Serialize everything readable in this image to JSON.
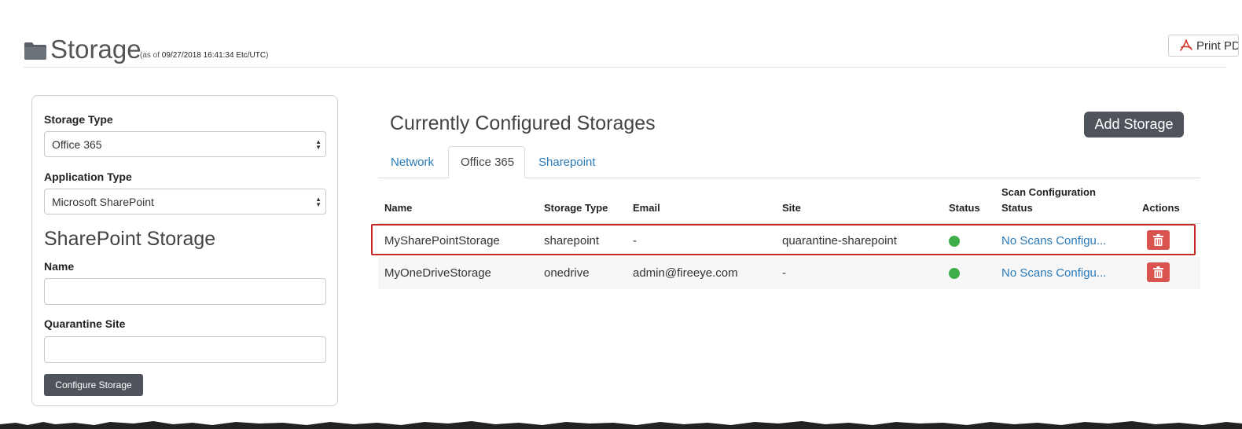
{
  "header": {
    "title": "Storage",
    "asof_prefix": "(as of ",
    "asof_value": "09/27/2018 16:41:34 Etc/UTC",
    "asof_suffix": ")",
    "print_label": "Print PDF"
  },
  "form": {
    "storage_type_label": "Storage Type",
    "storage_type_value": "Office 365",
    "application_type_label": "Application Type",
    "application_type_value": "Microsoft SharePoint",
    "section_title": "SharePoint Storage",
    "name_label": "Name",
    "name_value": "",
    "quarantine_label": "Quarantine Site",
    "quarantine_value": "",
    "configure_label": "Configure Storage"
  },
  "main": {
    "title": "Currently Configured Storages",
    "add_label": "Add Storage",
    "tabs": [
      {
        "label": "Network",
        "active": false
      },
      {
        "label": "Office 365",
        "active": true
      },
      {
        "label": "Sharepoint",
        "active": false
      }
    ],
    "columns": {
      "name": "Name",
      "storage_type": "Storage Type",
      "email": "Email",
      "site": "Site",
      "status": "Status",
      "scan_line1": "Scan Configuration",
      "scan_line2": "Status",
      "actions": "Actions"
    },
    "rows": [
      {
        "name": "MySharePointStorage",
        "storage_type": "sharepoint",
        "email": "-",
        "site": "quarantine-sharepoint",
        "status": "active",
        "scan": "No Scans Configu..."
      },
      {
        "name": "MyOneDriveStorage",
        "storage_type": "onedrive",
        "email": "admin@fireeye.com",
        "site": "-",
        "status": "active",
        "scan": "No Scans Configu..."
      }
    ]
  },
  "colors": {
    "status_ok": "#3fae49",
    "delete": "#d9534f",
    "link": "#2a7ab8",
    "highlight": "#c62828",
    "dark_button": "#4f545c"
  },
  "icons": {
    "folder": "folder-icon",
    "pdf": "pdf-icon",
    "trash": "trash-icon",
    "select_arrows": "select-arrows-icon"
  }
}
